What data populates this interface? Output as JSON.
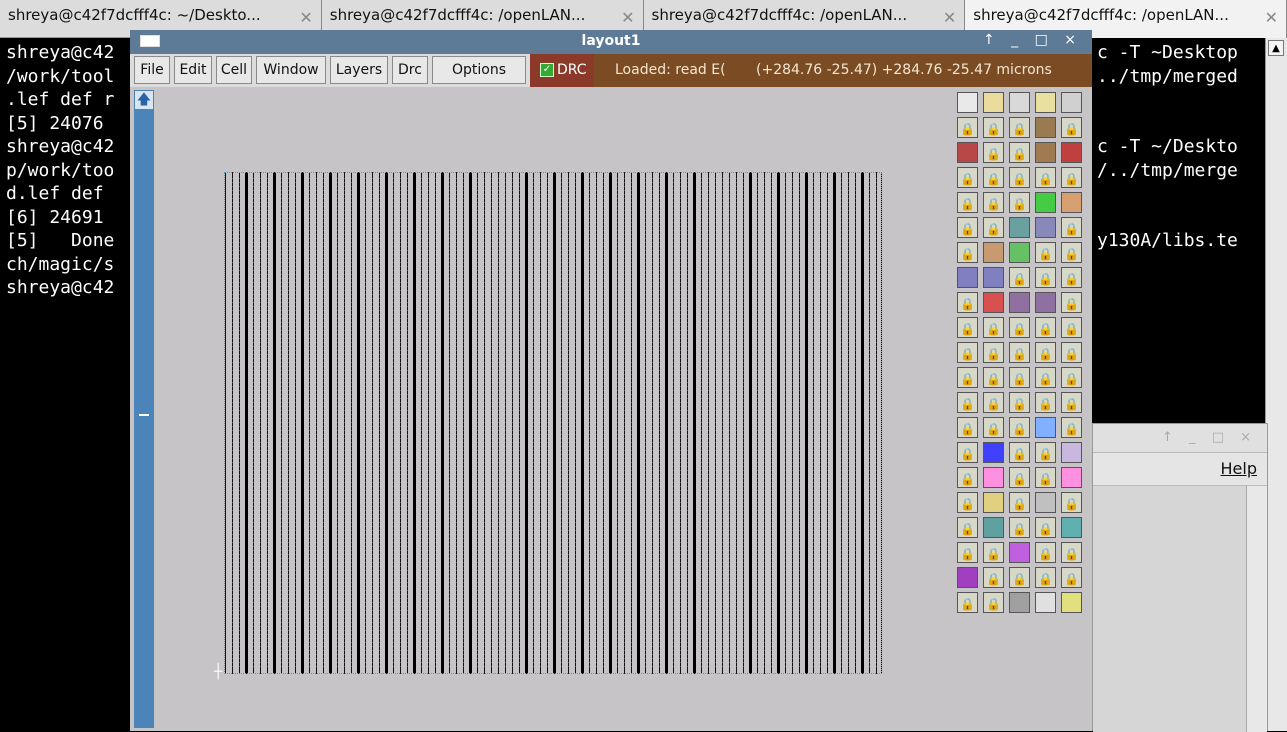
{
  "tabs": [
    {
      "label": "shreya@c42f7dcfff4c: ~/Deskto...",
      "active": false
    },
    {
      "label": "shreya@c42f7dcfff4c: /openLAN...",
      "active": false
    },
    {
      "label": "shreya@c42f7dcfff4c: /openLAN...",
      "active": false
    },
    {
      "label": "shreya@c42f7dcfff4c: /openLAN...",
      "active": true
    }
  ],
  "terminal": {
    "left_lines": [
      "shreya@c42",
      "/work/tool",
      ".lef def r",
      "[5] 24076",
      "shreya@c42",
      "p/work/too",
      "d.lef def",
      "[6] 24691",
      "[5]   Done",
      "ch/magic/s",
      "shreya@c42"
    ],
    "right_lines": [
      "c -T ~Desktop",
      "../tmp/merged",
      "",
      "",
      "c -T ~/Deskto",
      "/../tmp/merge",
      "",
      "",
      "y130A/libs.te"
    ]
  },
  "magic": {
    "title": "layout1",
    "window_controls": "↑ _ □ ×",
    "menu": [
      "File",
      "Edit",
      "Cell",
      "Window",
      "Layers",
      "Drc",
      "Options"
    ],
    "drc_label": "DRC",
    "status_loaded": "Loaded: read E(",
    "status_coords": "(+284.76 -25.47) +284.76 -25.47 microns"
  },
  "second_window": {
    "controls": "↑ _ □ ×",
    "help": "Help"
  },
  "palette_colors": [
    [
      "#e9e9e9",
      "#e9dc9c",
      "#d9d9d9",
      "#e9e0a0",
      "#d0d0d0"
    ],
    [
      "lock",
      "lock",
      "lock",
      "#9a7a50",
      "lock"
    ],
    [
      "#b84848",
      "lock",
      "lock",
      "#a07a50",
      "#c04040"
    ],
    [
      "lock",
      "lock",
      "lock",
      "lock",
      "lock"
    ],
    [
      "lock",
      "lock",
      "lock",
      "#44cc44",
      "#d8a070"
    ],
    [
      "lock",
      "lock",
      "#6aa0a0",
      "#8888bb",
      "lock"
    ],
    [
      "lock",
      "#c89a70",
      "#66c066",
      "lock",
      "lock"
    ],
    [
      "#8080c0",
      "#8080c0",
      "lock",
      "lock",
      "lock"
    ],
    [
      "lock",
      "#d85050",
      "#9070a0",
      "#9070a0",
      "lock"
    ],
    [
      "lock",
      "lock",
      "lock",
      "lock",
      "lock"
    ],
    [
      "lock",
      "lock",
      "lock",
      "lock",
      "lock"
    ],
    [
      "lock",
      "lock",
      "lock",
      "lock",
      "lock"
    ],
    [
      "lock",
      "lock",
      "lock",
      "lock",
      "lock"
    ],
    [
      "lock",
      "lock",
      "lock",
      "#80b0ff",
      "lock"
    ],
    [
      "lock",
      "#4040ff",
      "lock",
      "lock",
      "#c8b8e0"
    ],
    [
      "lock",
      "#ff90e0",
      "lock",
      "lock",
      "#ff90e0"
    ],
    [
      "lock",
      "#e0d080",
      "lock",
      "#c0c0c0",
      "lock"
    ],
    [
      "lock",
      "#60a0a0",
      "lock",
      "lock",
      "#60b0b0"
    ],
    [
      "lock",
      "lock",
      "#c060e0",
      "lock",
      "lock"
    ],
    [
      "#a040c0",
      "lock",
      "lock",
      "lock",
      "lock"
    ],
    [
      "lock",
      "lock",
      "#a0a0a0",
      "#e0e0e0",
      "#e0e080"
    ]
  ]
}
